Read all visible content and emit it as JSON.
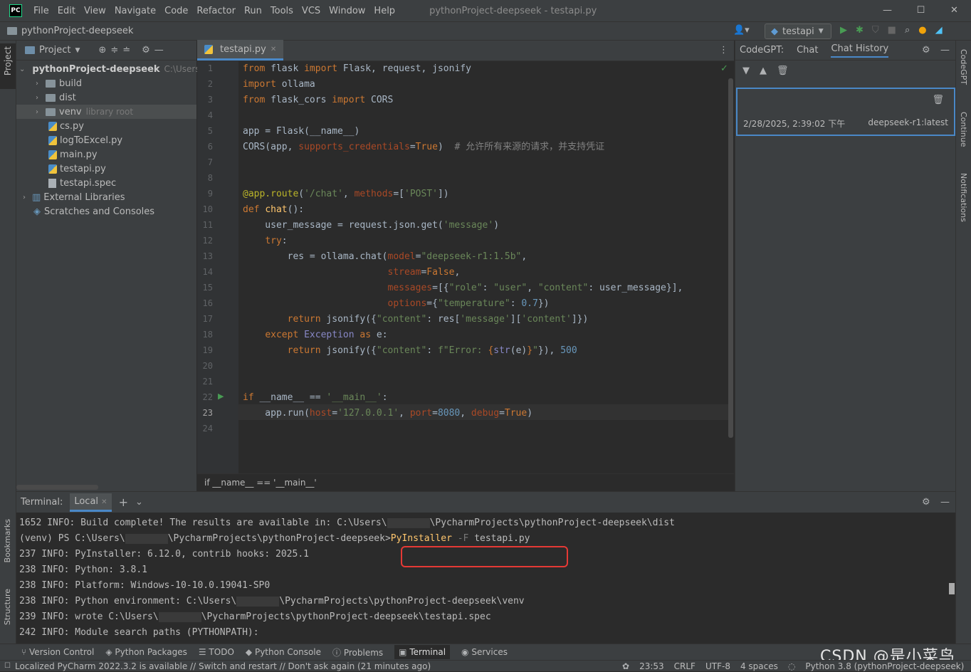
{
  "menubar": {
    "logo": "PC",
    "items": [
      "File",
      "Edit",
      "View",
      "Navigate",
      "Code",
      "Refactor",
      "Run",
      "Tools",
      "VCS",
      "Window",
      "Help"
    ],
    "title": "pythonProject-deepseek - testapi.py"
  },
  "navbar": {
    "project": "pythonProject-deepseek",
    "run_config": "testapi"
  },
  "left_strip": {
    "project": "Project",
    "bookmarks": "Bookmarks",
    "structure": "Structure"
  },
  "right_strip": {
    "codegpt": "CodeGPT",
    "continue": "Continue",
    "notifications": "Notifications"
  },
  "project_panel": {
    "title": "Project",
    "root": {
      "name": "pythonProject-deepseek",
      "path": "C:\\Users\\"
    },
    "items": [
      {
        "name": "build",
        "type": "folder"
      },
      {
        "name": "dist",
        "type": "folder"
      },
      {
        "name": "venv",
        "type": "folder",
        "note": "library root"
      },
      {
        "name": "cs.py",
        "type": "py"
      },
      {
        "name": "logToExcel.py",
        "type": "py"
      },
      {
        "name": "main.py",
        "type": "py"
      },
      {
        "name": "testapi.py",
        "type": "py"
      },
      {
        "name": "testapi.spec",
        "type": "spec"
      }
    ],
    "external": "External Libraries",
    "scratches": "Scratches and Consoles"
  },
  "editor": {
    "tab": "testapi.py",
    "line_numbers": [
      "1",
      "2",
      "3",
      "4",
      "5",
      "6",
      "7",
      "8",
      "9",
      "10",
      "11",
      "12",
      "13",
      "14",
      "15",
      "16",
      "17",
      "18",
      "19",
      "20",
      "21",
      "22",
      "23",
      "24"
    ],
    "breadcrumb": "if __name__ == '__main__'"
  },
  "codegpt": {
    "label": "CodeGPT:",
    "tabs": [
      "Chat",
      "Chat History"
    ],
    "history": [
      {
        "date": "2/28/2025, 2:39:02 下午",
        "model": "deepseek-r1:latest"
      }
    ]
  },
  "terminal": {
    "label": "Terminal:",
    "tab": "Local",
    "lines": [
      [
        "1652 INFO: Build complete! The results are available in: C:\\Users\\",
        "\\PycharmProjects\\pythonProject-deepseek\\dist"
      ],
      [
        "(venv) PS C:\\Users\\",
        "\\PycharmProjects\\pythonProject-deepseek>"
      ],
      [
        "237 INFO: PyInstaller: 6.12.0, contrib hooks: 2025.1"
      ],
      [
        "238 INFO: Python: 3.8.1"
      ],
      [
        "238 INFO: Platform: Windows-10-10.0.19041-SP0"
      ],
      [
        "238 INFO: Python environment: C:\\Users\\",
        "\\PycharmProjects\\pythonProject-deepseek\\venv"
      ],
      [
        "239 INFO: wrote C:\\Users\\",
        "\\PycharmProjects\\pythonProject-deepseek\\testapi.spec"
      ],
      [
        "242 INFO: Module search paths (PYTHONPATH):"
      ]
    ],
    "command": {
      "cmd": "PyInstaller",
      "flag": "-F",
      "arg": "testapi.py"
    }
  },
  "toolwindows": [
    "Version Control",
    "Python Packages",
    "TODO",
    "Python Console",
    "Problems",
    "Terminal",
    "Services"
  ],
  "statusbar": {
    "message": "Localized PyCharm 2022.3.2 is available // Switch and restart // Don't ask again (21 minutes ago)",
    "position": "23:53",
    "line_sep": "CRLF",
    "encoding": "UTF-8",
    "indent": "4 spaces",
    "interpreter": "Python 3.8 (pythonProject-deepseek)"
  },
  "watermark": "CSDN @是小菜鸟"
}
